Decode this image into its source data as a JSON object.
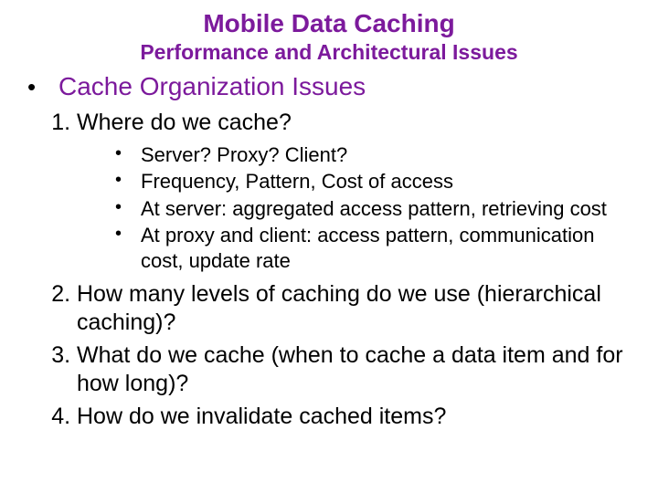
{
  "title": "Mobile Data Caching",
  "subtitle": "Performance and Architectural Issues",
  "heading": "Cache Organization Issues",
  "items": {
    "i1": "Where do we cache?",
    "i2": "How many levels of caching do we use (hierarchical caching)?",
    "i3": "What do we cache (when to cache a data item and for how long)?",
    "i4": "How do we invalidate cached items?"
  },
  "sub": {
    "s1": "Server? Proxy? Client?",
    "s2": "Frequency, Pattern, Cost of access",
    "s3": "At server:  aggregated access pattern, retrieving cost",
    "s4": "At proxy and client: access pattern, communication cost, update rate"
  }
}
